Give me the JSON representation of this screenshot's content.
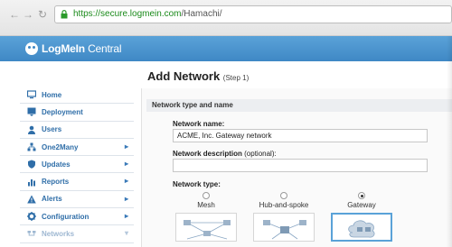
{
  "browser": {
    "url_secure": "https://secure.logmein.com",
    "url_path": "/Hamachi/"
  },
  "app": {
    "logo_brand": "LogMeIn",
    "logo_product": " Central"
  },
  "sidebar": {
    "items": [
      {
        "label": "Home",
        "icon": "monitor-icon",
        "has_submenu": false
      },
      {
        "label": "Deployment",
        "icon": "deployment-icon",
        "has_submenu": false
      },
      {
        "label": "Users",
        "icon": "user-icon",
        "has_submenu": false
      },
      {
        "label": "One2Many",
        "icon": "one2many-icon",
        "has_submenu": true
      },
      {
        "label": "Updates",
        "icon": "shield-icon",
        "has_submenu": true
      },
      {
        "label": "Reports",
        "icon": "bar-chart-icon",
        "has_submenu": true
      },
      {
        "label": "Alerts",
        "icon": "alert-icon",
        "has_submenu": true
      },
      {
        "label": "Configuration",
        "icon": "gear-icon",
        "has_submenu": true
      },
      {
        "label": "Networks",
        "icon": "network-icon",
        "has_submenu": true
      }
    ]
  },
  "main": {
    "title": "Add Network",
    "step": "(Step 1)",
    "section_title": "Network type and name",
    "network_name": {
      "label": "Network name:",
      "value": "ACME, Inc. Gateway network"
    },
    "network_description": {
      "label": "Network description",
      "optional": "(optional):",
      "value": ""
    },
    "network_type": {
      "label": "Network type:",
      "options": [
        {
          "label": "Mesh",
          "selected": false
        },
        {
          "label": "Hub-and-spoke",
          "selected": false
        },
        {
          "label": "Gateway",
          "selected": true
        }
      ]
    }
  },
  "colors": {
    "header_blue": "#3f88c5",
    "sidebar_text": "#2f6ea8",
    "secure_green": "#1a8a1a",
    "selected_border": "#5aa2d8"
  }
}
